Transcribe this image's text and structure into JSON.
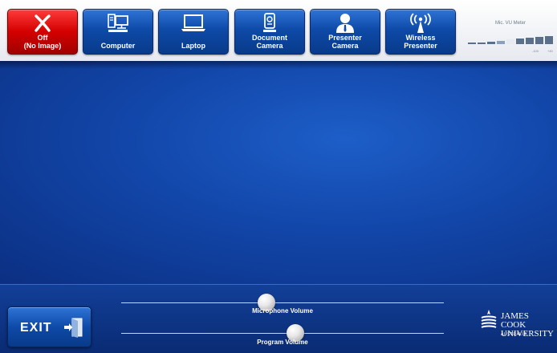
{
  "sources": [
    {
      "id": "off",
      "label": "Off\n(No Image)",
      "icon": "x-off-icon",
      "active": true
    },
    {
      "id": "computer",
      "label": "Computer",
      "icon": "desktop-computer-icon",
      "active": false
    },
    {
      "id": "laptop",
      "label": "Laptop",
      "icon": "laptop-icon",
      "active": false
    },
    {
      "id": "document-camera",
      "label": "Document\nCamera",
      "icon": "document-camera-icon",
      "active": false
    },
    {
      "id": "presenter-camera",
      "label": "Presenter\nCamera",
      "icon": "presenter-icon",
      "active": false
    },
    {
      "id": "wireless-presenter",
      "label": "Wireless\nPresenter",
      "icon": "wireless-antenna-icon",
      "active": false
    }
  ],
  "vu_meter": {
    "title": "Mic. VU Meter",
    "tick_left": "-100",
    "tick_right": "+40"
  },
  "exit": {
    "label": "EXIT",
    "icon": "exit-door-icon"
  },
  "sliders": {
    "microphone": {
      "label": "Microphone Volume",
      "level": 0.45
    },
    "program": {
      "label": "Program Volume",
      "level": 0.54
    }
  },
  "logo": {
    "name_line1": "JAMES COOK",
    "name_line2": "UNIVERSITY",
    "country": "AUSTRALIA"
  },
  "colors": {
    "active_source": "#d40000",
    "button_blue": "#0e4aa8",
    "stage_blue": "#1246a9"
  }
}
